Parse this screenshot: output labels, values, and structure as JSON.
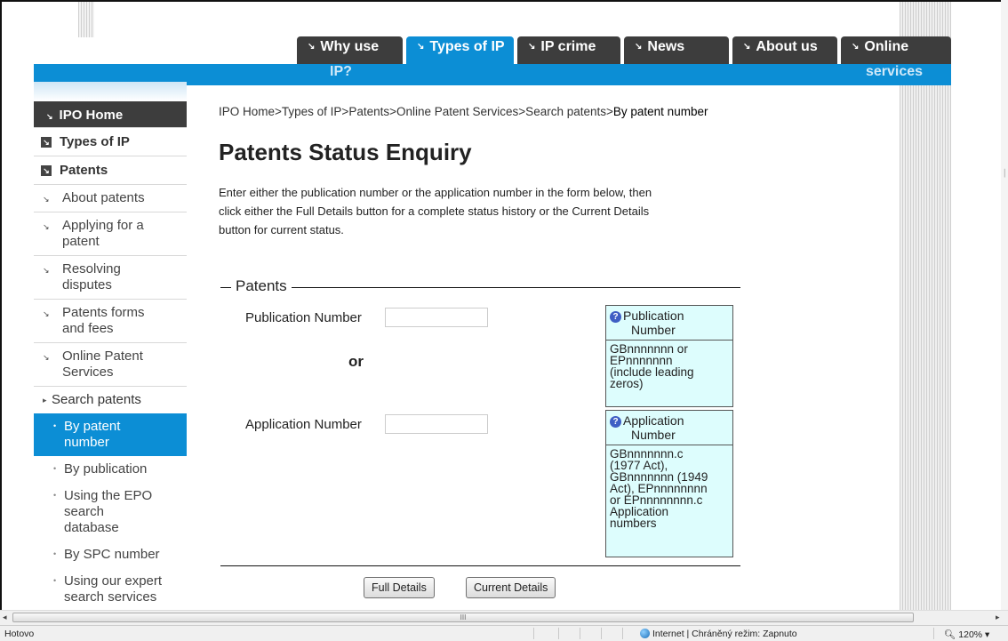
{
  "top_nav": {
    "tabs": [
      {
        "label": "Why use IP?",
        "line1": "Why use",
        "line2": "IP?",
        "active": false
      },
      {
        "label": "Types of IP",
        "active": true
      },
      {
        "label": "IP crime",
        "active": false
      },
      {
        "label": "News",
        "active": false
      },
      {
        "label": "About us",
        "active": false
      },
      {
        "label": "Online services",
        "line1": "Online",
        "line2": "services",
        "active": false
      }
    ]
  },
  "sidebar": {
    "home": "IPO Home",
    "types_of_ip": "Types of IP",
    "patents": "Patents",
    "items": [
      {
        "label": "About patents"
      },
      {
        "label": "Applying for a patent",
        "line1": "Applying for a",
        "line2": "patent"
      },
      {
        "label": "Resolving disputes",
        "line1": "Resolving",
        "line2": "disputes"
      },
      {
        "label": "Patents forms and fees",
        "line1": "Patents forms",
        "line2": "and fees"
      },
      {
        "label": "Online Patent Services",
        "line1": "Online Patent",
        "line2": "Services"
      }
    ],
    "search_patents": "Search patents",
    "sub_items": [
      {
        "label": "By patent number",
        "line1": "By patent",
        "line2": "number",
        "active": true
      },
      {
        "label": "By publication",
        "active": false
      },
      {
        "label": "Using the EPO search database",
        "line1": "Using the EPO",
        "line2": "search",
        "line3": "database",
        "active": false
      },
      {
        "label": "By SPC number",
        "active": false
      },
      {
        "label": "Using our expert search services",
        "line1": "Using our expert",
        "line2": "search services",
        "active": false
      }
    ]
  },
  "breadcrumb": {
    "trail": "IPO Home>Types of IP>Patents>Online Patent Services>Search patents>",
    "current": "By patent number"
  },
  "page": {
    "title": "Patents Status Enquiry",
    "intro_line1": "Enter either the publication number or the application number in the form below, then",
    "intro_line2": "click either the Full Details button for a complete status history or the Current Details",
    "intro_line3": "button for current status."
  },
  "form": {
    "legend": "Patents",
    "publication_label": "Publication Number",
    "publication_value": "",
    "or_text": "or",
    "application_label": "Application Number",
    "application_value": "",
    "help_publication": {
      "title_line1": "Publication",
      "title_line2": "Number",
      "body_lines": [
        "GBnnnnnnn or",
        "EPnnnnnnn",
        "(include leading",
        "zeros)"
      ]
    },
    "help_application": {
      "title_line1": "Application",
      "title_line2": "Number",
      "body_lines": [
        "GBnnnnnnn.c",
        "(1977 Act),",
        "GBnnnnnnn (1949",
        "Act), EPnnnnnnnn",
        "or EPnnnnnnnn.c",
        "Application",
        "numbers"
      ]
    },
    "full_details_button": "Full Details",
    "current_details_button": "Current Details"
  },
  "scrollbar": {
    "grip": "III"
  },
  "status_bar": {
    "left_text": "Hotovo",
    "zone_text": "Internet | Chráněný režim: Zapnuto",
    "zoom": "120%"
  },
  "colors": {
    "accent_blue": "#0c8ed5",
    "tab_dark": "#3d3d3d",
    "help_bg": "#ddfdfd"
  }
}
